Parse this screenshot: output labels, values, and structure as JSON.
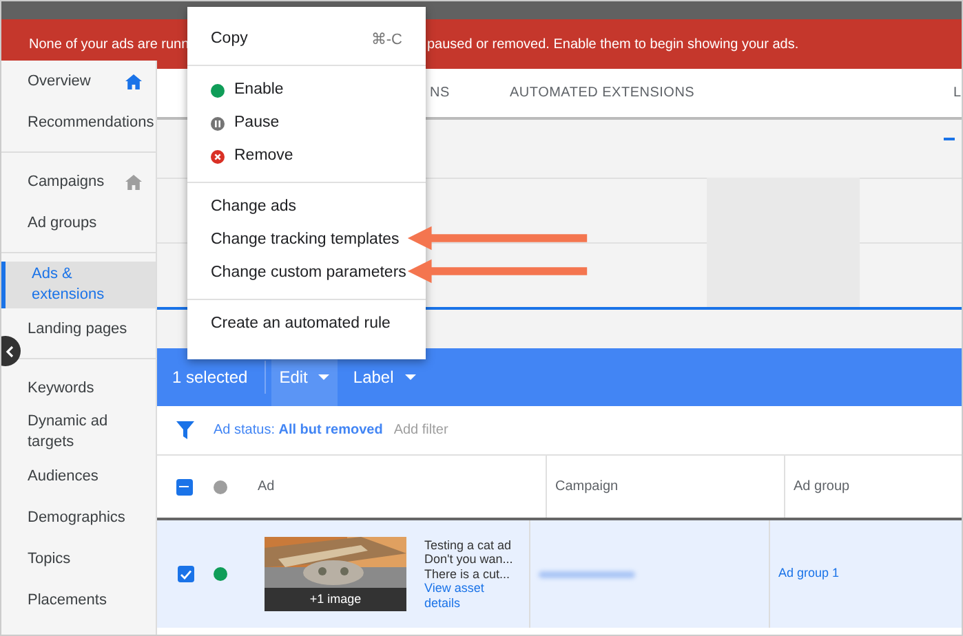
{
  "banner": {
    "text_parts": [
      "None of your ads are runn",
      "paused or removed. Enable them to begin showing your ads."
    ]
  },
  "sidebar": {
    "groups": [
      [
        {
          "label": "Overview",
          "selected": false,
          "color": "#1a73e8"
        },
        {
          "label": "Recommendations",
          "selected": false
        }
      ],
      [
        {
          "label": "Campaigns",
          "selected": false,
          "color": "#9e9e9e"
        },
        {
          "label": "Ad groups",
          "selected": false
        }
      ],
      [
        {
          "label": "Ads & extensions",
          "selected": true
        },
        {
          "label": "Landing pages",
          "selected": false
        }
      ],
      [
        {
          "label": "Keywords",
          "selected": false
        },
        {
          "label": "Dynamic ad targets",
          "selected": false
        },
        {
          "label": "Audiences",
          "selected": false
        },
        {
          "label": "Demographics",
          "selected": false
        },
        {
          "label": "Topics",
          "selected": false
        },
        {
          "label": "Placements",
          "selected": false
        }
      ]
    ]
  },
  "tabs": [
    {
      "label": "NS",
      "selected": false
    },
    {
      "label": "AUTOMATED EXTENSIONS",
      "selected": false
    },
    {
      "label": "L",
      "selected": false
    }
  ],
  "menu": {
    "sections": [
      [
        {
          "label": "Copy",
          "kind": "plain",
          "shortcut": "⌘-C"
        }
      ],
      [
        {
          "label": "Enable",
          "kind": "enable"
        },
        {
          "label": "Pause",
          "kind": "pause"
        },
        {
          "label": "Remove",
          "kind": "remove"
        }
      ],
      [
        {
          "label": "Change ads",
          "kind": "plain"
        },
        {
          "label": "Change tracking templates",
          "kind": "plain",
          "highlighted_by_arrow": true
        },
        {
          "label": "Change custom parameters",
          "kind": "plain",
          "highlighted_by_arrow": true
        }
      ],
      [
        {
          "label": "Create an automated rule",
          "kind": "plain"
        }
      ]
    ]
  },
  "action_bar": {
    "count": "1 selected",
    "buttons": [
      {
        "label": "Edit",
        "selected": true
      },
      {
        "label": "Label",
        "selected": false
      }
    ]
  },
  "filter": {
    "label": "Ad status: **All but removed**",
    "add": "Add filter"
  },
  "table": {
    "header_checkbox_indeterminate": true,
    "columns": [
      "Ad",
      "Campaign",
      "Ad group"
    ],
    "rows": [
      {
        "selected": true,
        "color": "#0f9d58",
        "image_caption": "+1 image",
        "ad_lines": [
          "Testing a cat ad",
          "Don't you wan...",
          "There is a cut..."
        ],
        "ad_link": "View asset details",
        "ad_group": "Ad group 1"
      }
    ]
  }
}
